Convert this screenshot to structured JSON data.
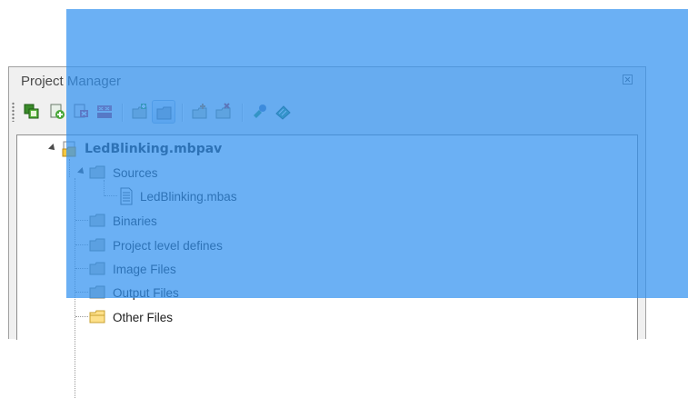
{
  "panel": {
    "title": "Project Manager",
    "close_label": "close"
  },
  "toolbar": {
    "buttons": [
      {
        "icon": "copy-project-icon"
      },
      {
        "icon": "add-file-icon"
      },
      {
        "icon": "remove-file-icon"
      },
      {
        "icon": "remove-all-icon"
      },
      {
        "icon": "add-folder-icon"
      },
      {
        "icon": "folder-view-icon",
        "pressed": true
      },
      {
        "icon": "new-folder-icon"
      },
      {
        "icon": "delete-folder-icon"
      },
      {
        "icon": "build-icon"
      },
      {
        "icon": "options-icon"
      }
    ]
  },
  "tree": {
    "root": "LedBlinking.mbpav",
    "sources": "Sources",
    "source_file": "LedBlinking.mbas",
    "folders": [
      "Binaries",
      "Project level defines",
      "Image Files",
      "Output Files",
      "Other Files"
    ]
  },
  "overlay": {
    "color": "#3291f0"
  }
}
